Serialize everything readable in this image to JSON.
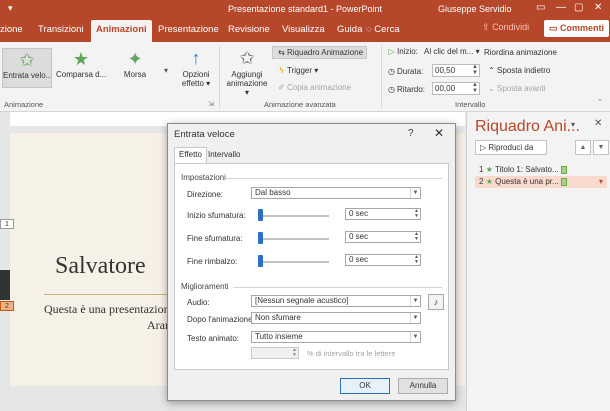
{
  "app": {
    "window_title": "Presentazione standard1  -  PowerPoint",
    "user": "Giuseppe Servidio"
  },
  "tabs": [
    "zione",
    "Transizioni",
    "Animazioni",
    "Presentazione",
    "Revisione",
    "Visualizza",
    "Guida"
  ],
  "search_label": "Cerca",
  "share_label": "Condividi",
  "comments_label": "Commenti",
  "ribbon": {
    "animations": [
      "Entrata velo...",
      "Comparsa d...",
      "Morsa"
    ],
    "effect_options": "Opzioni effetto",
    "group_animation": "Animazione",
    "add_animation": "Aggiungi animazione",
    "pane_button": "Riquadro Animazione",
    "trigger": "Trigger",
    "copy_animation": "Copia animazione",
    "group_advanced": "Animazione avanzata",
    "start_label": "Inizio:",
    "start_value": "Al clic del m...",
    "duration_label": "Durata:",
    "duration_value": "00,50",
    "delay_label": "Ritardo:",
    "delay_value": "00,00",
    "reorder_title": "Riordina animazione",
    "move_back": "Sposta indietro",
    "move_forward": "Sposta avanti",
    "group_timing": "Intervallo"
  },
  "slide": {
    "title": "Salvatore",
    "subtitle_line1": "Questa è una presentazion",
    "subtitle_line2": "Aran",
    "tag1": "1",
    "tag2": "2"
  },
  "pane": {
    "title": "Riquadro Ani...",
    "play_button": "Riproduci da",
    "items": [
      {
        "num": "1",
        "label": "Titolo 1: Salvato..."
      },
      {
        "num": "2",
        "label": "Questa è una pr..."
      }
    ]
  },
  "dialog": {
    "title": "Entrata veloce",
    "help": "?",
    "close": "✕",
    "tabs": [
      "Effetto",
      "Intervallo"
    ],
    "settings_section": "Impostazioni",
    "direction_label": "Direzione:",
    "direction_value": "Dal basso",
    "smooth_start_label": "Inizio sfumatura:",
    "smooth_start_value": "0 sec",
    "smooth_end_label": "Fine sfumatura:",
    "smooth_end_value": "0 sec",
    "bounce_end_label": "Fine rimbalzo:",
    "bounce_end_value": "0 sec",
    "enhancements_section": "Miglioramenti",
    "sound_label": "Audio:",
    "sound_value": "[Nessun segnale acustico]",
    "after_label": "Dopo l'animazione:",
    "after_value": "Non sfumare",
    "animate_text_label": "Testo animato:",
    "animate_text_value": "Tutto insieme",
    "delay_letters_note": "% di intervallo tra le lettere",
    "ok": "OK",
    "cancel": "Annulla"
  },
  "colors": {
    "accent": "#b7472a",
    "selection": "#2d6fc2"
  }
}
